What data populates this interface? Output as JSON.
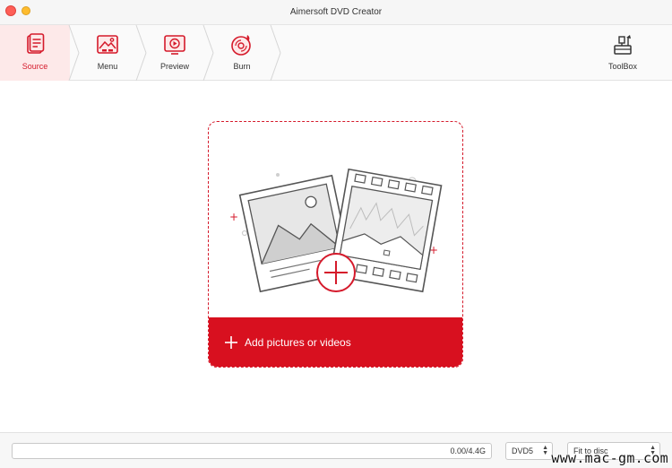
{
  "window": {
    "title": "Aimersoft DVD Creator"
  },
  "steps": [
    {
      "label": "Source",
      "icon": "source-icon",
      "active": true
    },
    {
      "label": "Menu",
      "icon": "menu-icon",
      "active": false
    },
    {
      "label": "Preview",
      "icon": "preview-icon",
      "active": false
    },
    {
      "label": "Burn",
      "icon": "burn-icon",
      "active": false
    }
  ],
  "toolbox": {
    "label": "ToolBox",
    "icon": "toolbox-icon"
  },
  "dropzone": {
    "add_label": "Add pictures or videos"
  },
  "bottom": {
    "capacity_text": "0.00/4.4G",
    "disc_type": "DVD5",
    "fit_mode": "Fit to disc"
  },
  "watermark": "www.mac-gm.com",
  "colors": {
    "accent": "#d8101f",
    "active_step_bg": "#fde9e9"
  }
}
